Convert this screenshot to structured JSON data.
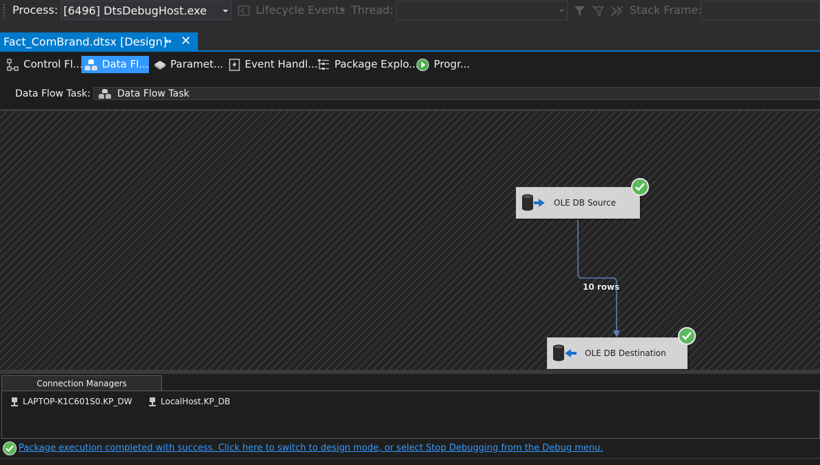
{
  "debug_toolbar": {
    "process_label": "Process:",
    "process_value": "[6496] DtsDebugHost.exe",
    "lifecycle_events": "Lifecycle Events",
    "thread_label": "Thread:",
    "thread_value": "",
    "stack_frame_label": "Stack Frame:",
    "stack_frame_value": ""
  },
  "document_tab": {
    "title": "Fact_ComBrand.dtsx [Design]",
    "pin_icon": "pin-icon",
    "close_icon": "close-icon"
  },
  "designer_tabs": [
    {
      "label": "Control Fl...",
      "icon": "control-flow-icon",
      "active": false
    },
    {
      "label": "Data Fl...",
      "icon": "data-flow-icon",
      "active": true
    },
    {
      "label": "Paramet...",
      "icon": "parameters-icon",
      "active": false
    },
    {
      "label": "Event Handl...",
      "icon": "event-handlers-icon",
      "active": false
    },
    {
      "label": "Package Explo...",
      "icon": "package-explorer-icon",
      "active": false
    },
    {
      "label": "Progr...",
      "icon": "progress-icon",
      "active": false
    }
  ],
  "task_selector": {
    "label": "Data Flow Task:",
    "value": "Data Flow Task"
  },
  "canvas": {
    "components": [
      {
        "name": "OLE DB Source",
        "status": "success"
      },
      {
        "name": "OLE DB Destination",
        "status": "success"
      }
    ],
    "path_label": "10 rows"
  },
  "connection_managers": {
    "tab_label": "Connection Managers",
    "items": [
      {
        "label": "LAPTOP-K1C601S0.KP_DW",
        "icon": "connection-icon"
      },
      {
        "label": "LocalHost.KP_DB",
        "icon": "connection-icon"
      }
    ]
  },
  "status": {
    "message": "Package execution completed with success. Click here to switch to design mode, or select Stop Debugging from the Debug menu."
  },
  "colors": {
    "accent": "#007acc",
    "active_tab": "#3399ff",
    "success": "#5cb85c",
    "link": "#3399ff",
    "background": "#1e1e1e"
  }
}
